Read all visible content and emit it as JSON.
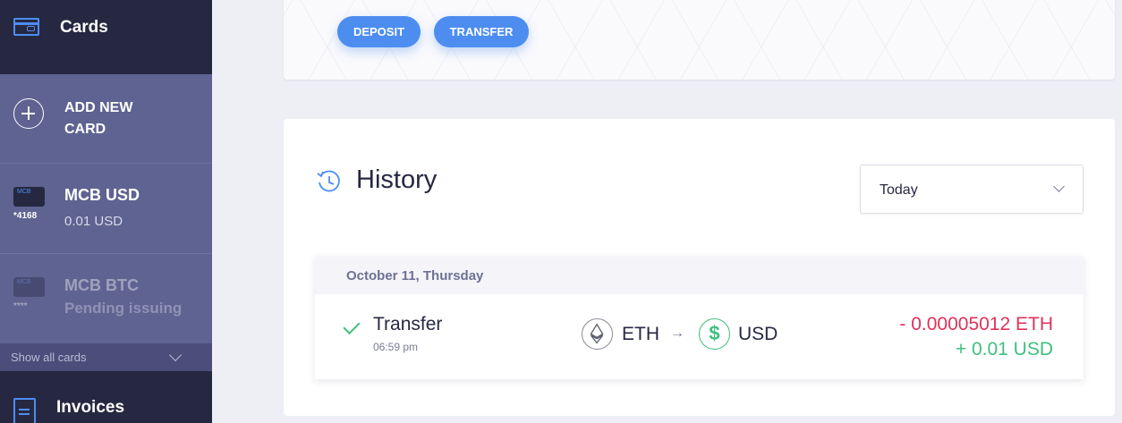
{
  "sidebar": {
    "title": "Cards",
    "add_card_label": "ADD NEW CARD",
    "cards": [
      {
        "mini_label": "MCB",
        "number": "*4168",
        "name": "MCB USD",
        "balance": "0.01 USD"
      },
      {
        "mini_label": "MCB",
        "number": "****",
        "name": "MCB BTC",
        "balance": "Pending issuing"
      }
    ],
    "show_all_label": "Show all cards",
    "invoices_label": "Invoices"
  },
  "actions": {
    "deposit_label": "DEPOSIT",
    "transfer_label": "TRANSFER"
  },
  "history": {
    "title": "History",
    "filter_value": "Today",
    "groups": [
      {
        "date": "October 11, Thursday",
        "transactions": [
          {
            "type": "Transfer",
            "time": "06:59 pm",
            "from_currency": "ETH",
            "to_currency": "USD",
            "amount_out": "- 0.00005012 ETH",
            "amount_in": "+ 0.01 USD"
          }
        ]
      }
    ]
  },
  "colors": {
    "accent": "#4d8df0",
    "sidebar": "#5f6391",
    "sidebar_dark": "#262842",
    "positive": "#3fbf7f",
    "negative": "#e0325a"
  },
  "icons": {
    "cards": "credit-card-icon",
    "add": "plus-circle-icon",
    "history": "history-clock-icon",
    "invoices": "document-icon",
    "eth": "ethereum-icon",
    "usd": "dollar-icon",
    "status": "checkmark-icon"
  }
}
